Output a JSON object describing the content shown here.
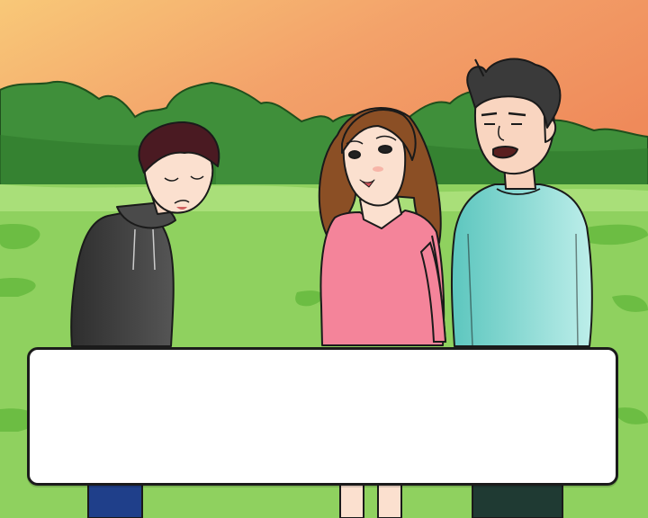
{
  "scene": {
    "setting": "park-at-sunset",
    "colors": {
      "sky_top": "#f0a070",
      "sky_bottom": "#f7c77a",
      "trees": "#3d8f3a",
      "grass": "#8fd15f",
      "grass_dark": "#6cbd43",
      "hoodie": "#3a3a3a",
      "dress": "#f4849a",
      "shirt": "#7fd6cf"
    }
  },
  "characters": [
    {
      "id": "boy-hoodie",
      "icon": "sad-boy-icon"
    },
    {
      "id": "girl-pink-dress",
      "icon": "girl-icon"
    },
    {
      "id": "man-teal-shirt",
      "icon": "man-icon"
    }
  ],
  "dialog": {
    "speaker": "",
    "text": ""
  }
}
